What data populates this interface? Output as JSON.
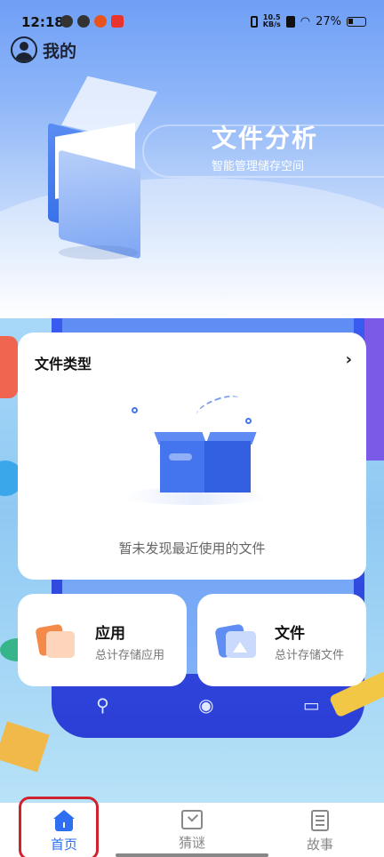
{
  "status_bar": {
    "time": "12:18",
    "net_speed_value": "10.5",
    "net_speed_unit": "KB/s",
    "battery": "27%"
  },
  "header": {
    "profile_label": "我的"
  },
  "hero": {
    "title": "文件分析",
    "subtitle": "智能管理储存空间"
  },
  "file_types": {
    "title": "文件类型",
    "chevron": "›",
    "empty_text": "暂未发现最近使用的文件"
  },
  "cards": {
    "apps": {
      "title": "应用",
      "subtitle": "总计存储应用",
      "icon": "apps-icon"
    },
    "files": {
      "title": "文件",
      "subtitle": "总计存储文件",
      "icon": "files-icon"
    }
  },
  "bottom_nav": {
    "items": [
      {
        "label": "首页",
        "icon": "home-icon",
        "active": true
      },
      {
        "label": "猜谜",
        "icon": "riddle-icon",
        "active": false
      },
      {
        "label": "故事",
        "icon": "story-icon",
        "active": false
      }
    ]
  },
  "colors": {
    "accent": "#2d6ff0",
    "highlight": "#d0212e"
  }
}
